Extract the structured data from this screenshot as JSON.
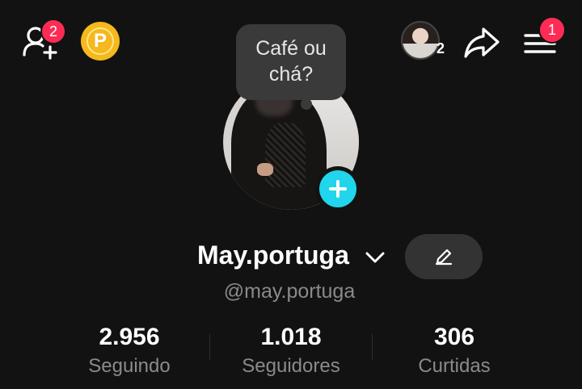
{
  "topbar": {
    "add_friends_badge": "2",
    "coin_letter": "P",
    "mini_avatar_count": "2",
    "menu_badge": "1"
  },
  "bubble": {
    "line1": "Café ou",
    "line2": "chá?"
  },
  "profile": {
    "display_name": "May.portuga",
    "handle": "@may.portuga"
  },
  "stats": [
    {
      "value": "2.956",
      "label": "Seguindo"
    },
    {
      "value": "1.018",
      "label": "Seguidores"
    },
    {
      "value": "306",
      "label": "Curtidas"
    }
  ],
  "colors": {
    "background": "#121212",
    "badge": "#fe2c55",
    "accent_plus": "#20d5ec",
    "coin": "#f5b81d",
    "muted_text": "#8a8a8a"
  },
  "icons": [
    "add-friend-icon",
    "coin-icon",
    "share-icon",
    "menu-icon",
    "chevron-down-icon",
    "pencil-icon",
    "plus-icon"
  ]
}
